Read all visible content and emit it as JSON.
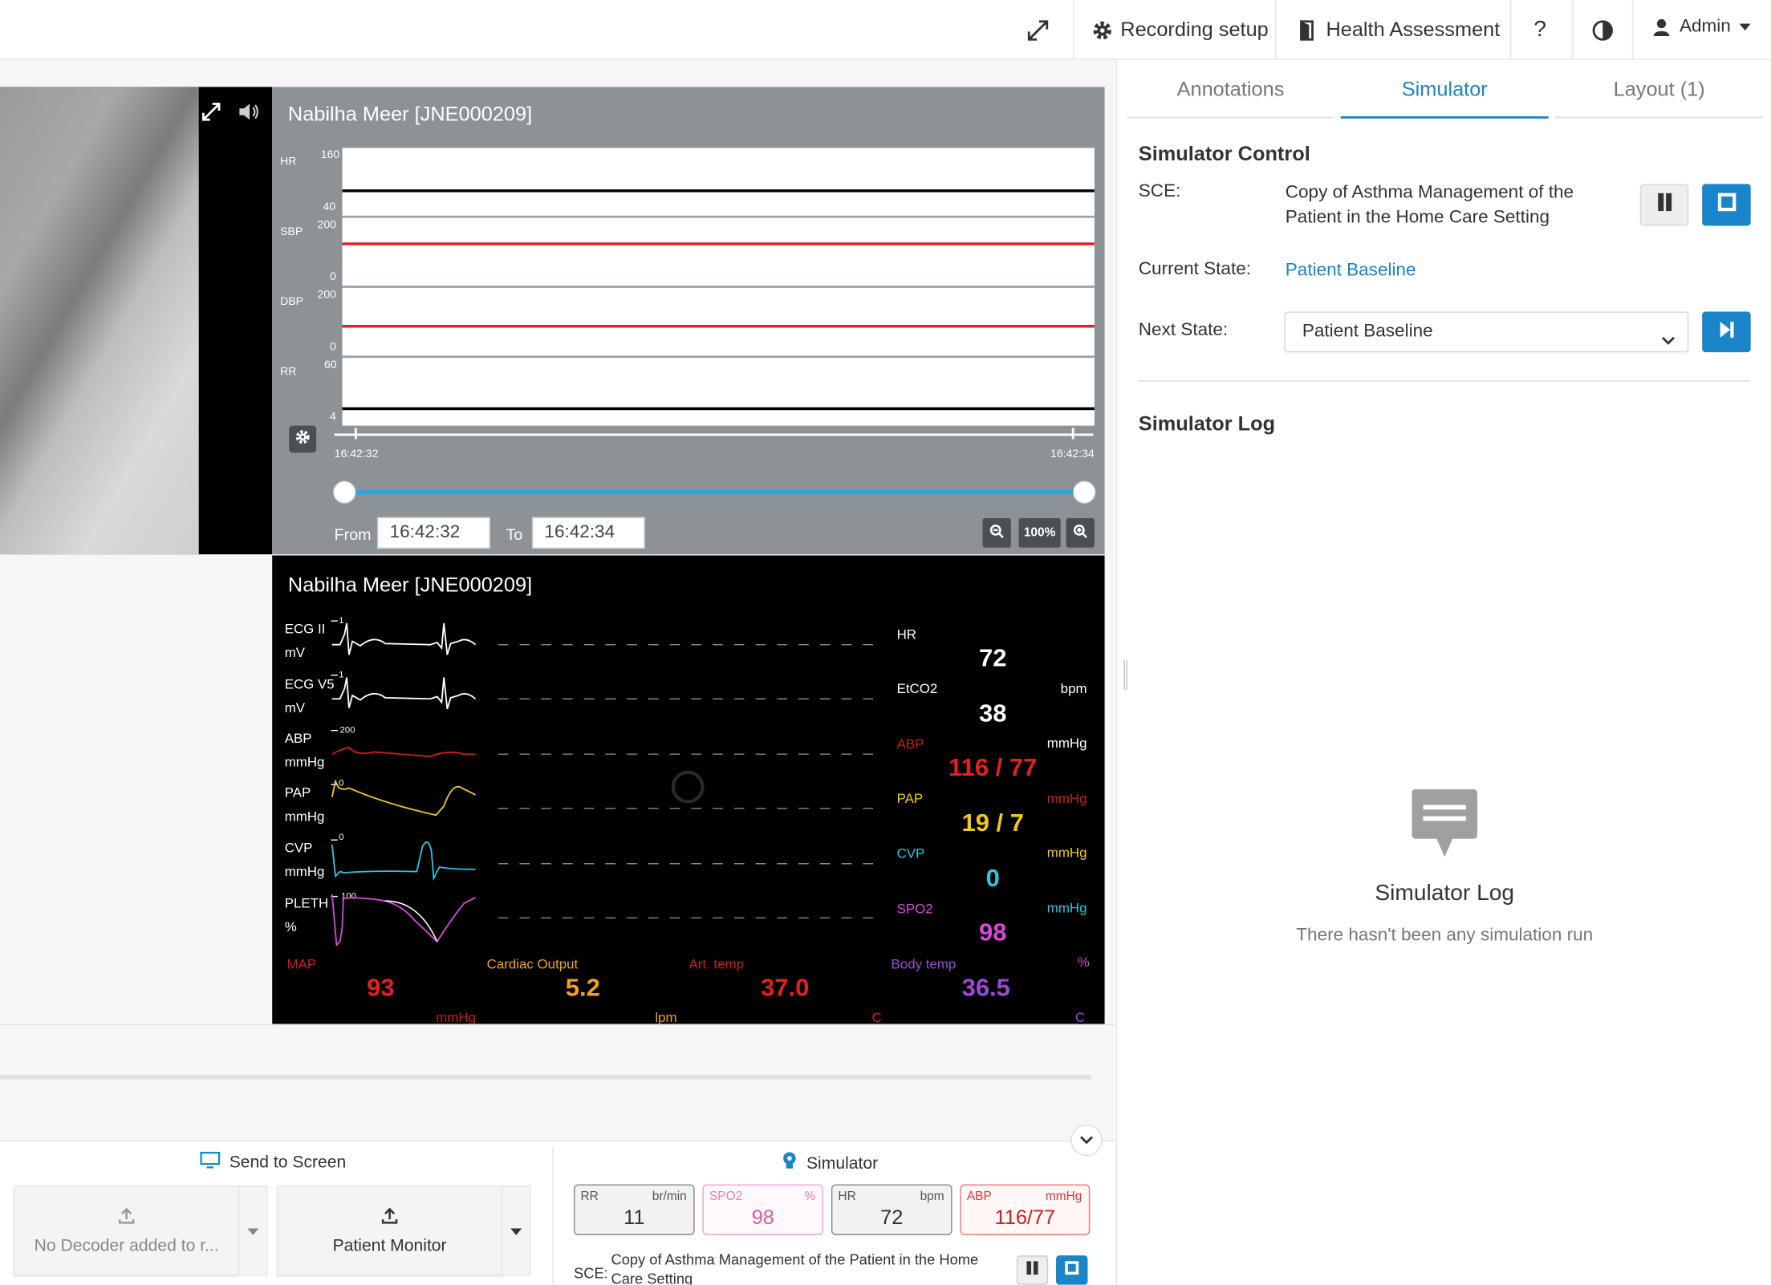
{
  "topbar": {
    "recording_setup": "Recording setup",
    "health_assessment": "Health Assessment",
    "help": "?",
    "user": "Admin"
  },
  "trend": {
    "patient": "Nabilha Meer [JNE000209]",
    "channels": [
      {
        "name": "HR",
        "max": "160",
        "min": "40"
      },
      {
        "name": "SBP",
        "max": "200",
        "min": "0"
      },
      {
        "name": "DBP",
        "max": "200",
        "min": "0"
      },
      {
        "name": "RR",
        "max": "60",
        "min": "4"
      }
    ],
    "time_start": "16:42:32",
    "time_end": "16:42:34",
    "from_label": "From",
    "to_label": "To",
    "from_value": "16:42:32",
    "to_value": "16:42:34",
    "zoom_level": "100%"
  },
  "monitor": {
    "patient": "Nabilha Meer [JNE000209]",
    "waves": [
      {
        "name": "ECG II",
        "unit": "mV",
        "scale": "1"
      },
      {
        "name": "ECG V5",
        "unit": "mV",
        "scale": "1"
      },
      {
        "name": "ABP",
        "unit": "mmHg",
        "scale": "200"
      },
      {
        "name": "PAP",
        "unit": "mmHg",
        "scale": "0"
      },
      {
        "name": "CVP",
        "unit": "mmHg",
        "scale": "0"
      },
      {
        "name": "PLETH",
        "unit": "%",
        "scale": "100"
      }
    ],
    "numerics": {
      "hr_label": "HR",
      "hr_value": "72",
      "etco2_label": "EtCO2",
      "etco2_value": "38",
      "bpm_unit": "bpm",
      "abp_label": "ABP",
      "abp_value": "116 / 77",
      "mmhg_unit": "mmHg",
      "pap_label": "PAP",
      "pap_value": "19 / 7",
      "pap_unit": "mmHg",
      "cvp_label": "CVP",
      "cvp_value": "0",
      "cvp_unit": "mmHg",
      "spo2_label": "SPO2",
      "spo2_value": "98",
      "spo2_unit": "mmHg",
      "pct_unit": "%"
    },
    "bottom": {
      "map_label": "MAP",
      "map_value": "93",
      "map_unit": "mmHg",
      "co_label": "Cardiac Output",
      "co_value": "5.2",
      "co_unit": "lpm",
      "art_label": "Art. temp",
      "art_value": "37.0",
      "art_unit": "C",
      "body_label": "Body temp",
      "body_value": "36.5",
      "body_unit": "C"
    }
  },
  "dock": {
    "send_to_screen": "Send to Screen",
    "no_decoder": "No Decoder added to r...",
    "patient_monitor": "Patient Monitor",
    "simulator": "Simulator",
    "vitals": [
      {
        "name": "RR",
        "unit": "br/min",
        "value": "11"
      },
      {
        "name": "SPO2",
        "unit": "%",
        "value": "98"
      },
      {
        "name": "HR",
        "unit": "bpm",
        "value": "72"
      },
      {
        "name": "ABP",
        "unit": "mmHg",
        "value": "116/77"
      }
    ],
    "sce_label": "SCE:",
    "sce_text": "Copy of Asthma Management of the Patient in the Home Care Setting"
  },
  "right": {
    "tabs": [
      "Annotations",
      "Simulator",
      "Layout (1)"
    ],
    "control_title": "Simulator Control",
    "sce_label": "SCE:",
    "sce_value": "Copy of Asthma Management of the Patient in the Home Care Setting",
    "current_label": "Current State:",
    "current_value": "Patient Baseline",
    "next_label": "Next State:",
    "next_value": "Patient Baseline",
    "log_title": "Simulator Log",
    "empty_title": "Simulator Log",
    "empty_sub": "There hasn't been any simulation run"
  },
  "colors": {
    "accent": "#1a85c8",
    "abp": "#e81f1f",
    "pap": "#f2c81a",
    "cvp": "#29c8e0",
    "spo2": "#d94ad9",
    "cardiac_output": "#f2a31a",
    "body_temp": "#9a4ad9"
  }
}
